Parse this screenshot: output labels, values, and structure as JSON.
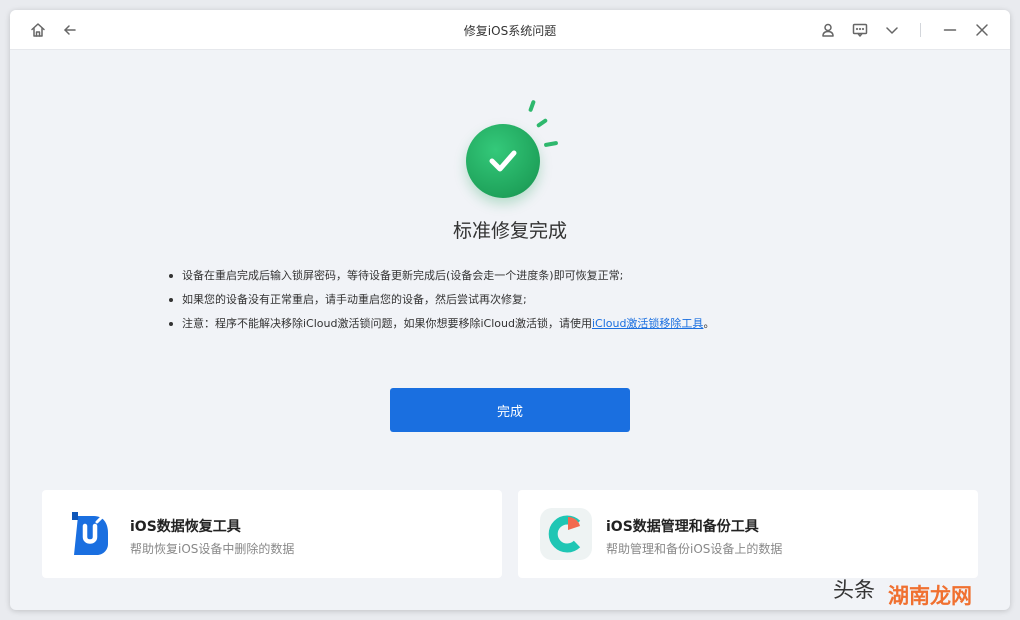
{
  "window": {
    "title": "修复iOS系统问题",
    "icons": {
      "home": "home-icon",
      "back": "arrow-left-icon",
      "account": "user-icon",
      "feedback": "message-icon",
      "menu": "chevron-down-icon",
      "minimize": "minimize-icon",
      "close": "close-icon"
    }
  },
  "result": {
    "status_icon": "check-circle-icon",
    "headline": "标准修复完成",
    "notes": [
      "设备在重启完成后输入锁屏密码，等待设备更新完成后(设备会走一个进度条)即可恢复正常;",
      "如果您的设备没有正常重启，请手动重启您的设备，然后尝试再次修复;"
    ],
    "note3_prefix": "注意：程序不能解决移除iCloud激活锁问题，如果你想要移除iCloud激活锁，请使用",
    "note3_link": "iCloud激活锁移除工具",
    "note3_suffix": "。",
    "done_label": "完成"
  },
  "cards": [
    {
      "title": "iOS数据恢复工具",
      "subtitle": "帮助恢复iOS设备中删除的数据",
      "icon": "data-recovery-logo-icon"
    },
    {
      "title": "iOS数据管理和备份工具",
      "subtitle": "帮助管理和备份iOS设备上的数据",
      "icon": "data-backup-logo-icon"
    }
  ],
  "watermark": {
    "text1": "头条",
    "text2": "湖南龙网"
  },
  "colors": {
    "accent": "#1a6fe0",
    "success": "#1fa35b",
    "background": "#f1f3f7"
  }
}
